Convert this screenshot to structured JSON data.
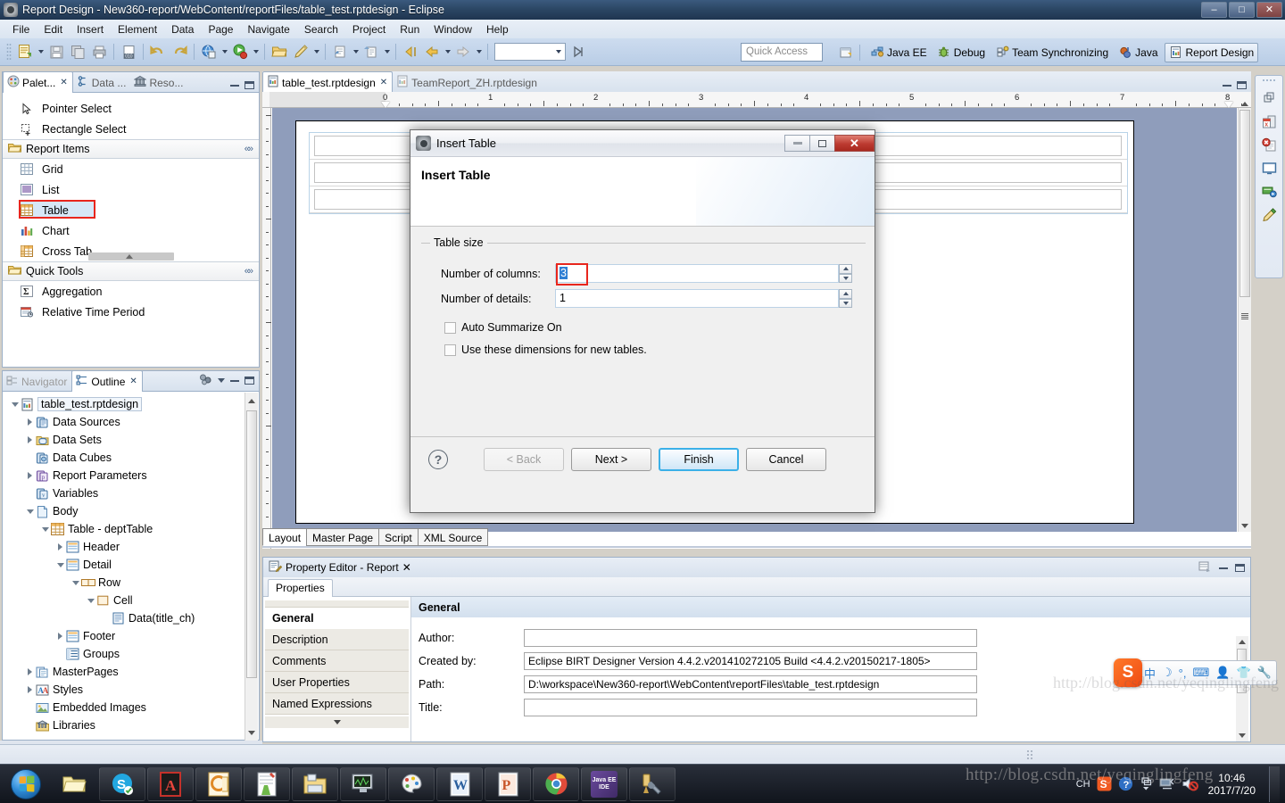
{
  "window": {
    "title": "Report Design - New360-report/WebContent/reportFiles/table_test.rptdesign - Eclipse",
    "minimize": "–",
    "maximize": "□",
    "close": "✕"
  },
  "menu": [
    "File",
    "Edit",
    "Insert",
    "Element",
    "Data",
    "Page",
    "Navigate",
    "Search",
    "Project",
    "Run",
    "Window",
    "Help"
  ],
  "toolbar": {
    "icons": [
      "new-report-icon",
      "save-icon",
      "save-all-icon",
      "print-icon",
      "data-binding-icon",
      "undo-icon",
      "redo-icon",
      "preview-web-icon",
      "run-report-icon",
      "open-folder-icon",
      "edit-pencil-icon",
      "publish-icon",
      "export-icon",
      "previous-page-icon",
      "back-icon",
      "forward-icon"
    ],
    "combo_value": ""
  },
  "quick_access": {
    "placeholder": "Quick Access"
  },
  "perspectives": [
    {
      "label": "Java EE",
      "icon": "java-ee-icon",
      "active": false
    },
    {
      "label": "Debug",
      "icon": "debug-icon",
      "active": false
    },
    {
      "label": "Team Synchronizing",
      "icon": "team-sync-icon",
      "active": false
    },
    {
      "label": "Java",
      "icon": "java-icon",
      "active": false
    },
    {
      "label": "Report Design",
      "icon": "report-design-icon",
      "active": true
    }
  ],
  "palette": {
    "tabs": [
      {
        "label": "Palet...",
        "icon": "palette-icon",
        "active": true,
        "closable": true
      },
      {
        "label": "Data ...",
        "icon": "data-explorer-icon",
        "active": false,
        "closable": false
      },
      {
        "label": "Reso...",
        "icon": "resource-explorer-icon",
        "active": false,
        "closable": false
      }
    ],
    "tools": [
      {
        "label": "Pointer Select",
        "icon": "pointer-select-icon"
      },
      {
        "label": "Rectangle Select",
        "icon": "rectangle-select-icon"
      }
    ],
    "sections": [
      {
        "label": "Report Items",
        "icon": "folder-open-icon",
        "items": [
          {
            "label": "Grid",
            "icon": "grid-icon",
            "selected": false
          },
          {
            "label": "List",
            "icon": "list-icon",
            "selected": false
          },
          {
            "label": "Table",
            "icon": "table-icon",
            "selected": true
          },
          {
            "label": "Chart",
            "icon": "chart-icon",
            "selected": false
          },
          {
            "label": "Cross Tab",
            "icon": "cross-tab-icon",
            "selected": false
          }
        ]
      },
      {
        "label": "Quick Tools",
        "icon": "folder-open-icon",
        "items": [
          {
            "label": "Aggregation",
            "icon": "aggregation-icon",
            "selected": false
          },
          {
            "label": "Relative Time Period",
            "icon": "relative-time-period-icon",
            "selected": false
          }
        ]
      }
    ]
  },
  "outline": {
    "tabs": [
      {
        "label": "Navigator",
        "icon": "navigator-icon",
        "active": false
      },
      {
        "label": "Outline",
        "icon": "outline-icon",
        "active": true,
        "closable": true
      }
    ],
    "tree": [
      {
        "label": "table_test.rptdesign",
        "depth": 0,
        "arrow": "open",
        "icon": "report-file-icon",
        "selected": true
      },
      {
        "label": "Data Sources",
        "depth": 1,
        "arrow": "closed",
        "icon": "data-sources-icon"
      },
      {
        "label": "Data Sets",
        "depth": 1,
        "arrow": "closed",
        "icon": "data-sets-icon"
      },
      {
        "label": "Data Cubes",
        "depth": 1,
        "arrow": "none",
        "icon": "data-cubes-icon"
      },
      {
        "label": "Report Parameters",
        "depth": 1,
        "arrow": "closed",
        "icon": "report-parameters-icon"
      },
      {
        "label": "Variables",
        "depth": 1,
        "arrow": "none",
        "icon": "variables-icon"
      },
      {
        "label": "Body",
        "depth": 1,
        "arrow": "open",
        "icon": "body-icon"
      },
      {
        "label": "Table - deptTable",
        "depth": 2,
        "arrow": "open",
        "icon": "table-icon"
      },
      {
        "label": "Header",
        "depth": 3,
        "arrow": "closed",
        "icon": "band-icon"
      },
      {
        "label": "Detail",
        "depth": 3,
        "arrow": "open",
        "icon": "band-icon"
      },
      {
        "label": "Row",
        "depth": 4,
        "arrow": "open",
        "icon": "row-icon"
      },
      {
        "label": "Cell",
        "depth": 5,
        "arrow": "open",
        "icon": "cell-icon"
      },
      {
        "label": "Data(title_ch)",
        "depth": 6,
        "arrow": "none",
        "icon": "data-item-icon"
      },
      {
        "label": "Footer",
        "depth": 3,
        "arrow": "closed",
        "icon": "band-icon"
      },
      {
        "label": "Groups",
        "depth": 3,
        "arrow": "none",
        "icon": "groups-icon"
      },
      {
        "label": "MasterPages",
        "depth": 1,
        "arrow": "closed",
        "icon": "master-pages-icon"
      },
      {
        "label": "Styles",
        "depth": 1,
        "arrow": "closed",
        "icon": "styles-icon"
      },
      {
        "label": "Embedded Images",
        "depth": 1,
        "arrow": "none",
        "icon": "embedded-images-icon"
      },
      {
        "label": "Libraries",
        "depth": 1,
        "arrow": "none",
        "icon": "libraries-icon"
      }
    ]
  },
  "editor": {
    "tabs": [
      {
        "label": "table_test.rptdesign",
        "icon": "report-file-icon",
        "active": true,
        "closable": true
      },
      {
        "label": "TeamReport_ZH.rptdesign",
        "icon": "report-file-icon",
        "active": false,
        "closable": false
      }
    ],
    "ruler_units": [
      "0",
      "1",
      "2",
      "3",
      "4",
      "5",
      "6",
      "7",
      "8"
    ],
    "layout_tabs": [
      {
        "label": "Layout",
        "mnemonic": "o",
        "active": true
      },
      {
        "label": "Master Page",
        "mnemonic": "M",
        "active": false
      },
      {
        "label": "Script",
        "mnemonic": "S",
        "active": false
      },
      {
        "label": "XML Source",
        "mnemonic": "X",
        "active": false
      }
    ]
  },
  "property_editor": {
    "view_title": "Property Editor - Report",
    "view_icon": "property-editor-icon",
    "tab": "Properties",
    "side_items": [
      {
        "label": "General",
        "active": true
      },
      {
        "label": "Description",
        "active": false
      },
      {
        "label": "Comments",
        "active": false
      },
      {
        "label": "User Properties",
        "active": false
      },
      {
        "label": "Named Expressions",
        "active": false
      }
    ],
    "section_title": "General",
    "fields": [
      {
        "label": "Author:",
        "mnemonic": "u",
        "value": ""
      },
      {
        "label": "Created by:",
        "mnemonic": "C",
        "value": "Eclipse BIRT Designer Version 4.4.2.v201410272105 Build <4.4.2.v20150217-1805>"
      },
      {
        "label": "Path:",
        "mnemonic": "P",
        "value": "D:\\workspace\\New360-report\\WebContent\\reportFiles\\table_test.rptdesign"
      },
      {
        "label": "Title:",
        "mnemonic": "i",
        "value": ""
      }
    ]
  },
  "fast_view": {
    "icons": [
      "restore-icon",
      "excel-report-icon",
      "error-log-icon",
      "console-icon",
      "servers-icon",
      "outline-pencil-icon"
    ]
  },
  "dialog": {
    "window_title": "Insert Table",
    "heading": "Insert Table",
    "group_label": "Table size",
    "fields": [
      {
        "label": "Number of columns:",
        "value": "3",
        "focused": true
      },
      {
        "label": "Number of details:",
        "value": "1",
        "focused": false
      }
    ],
    "checkboxes": [
      {
        "label": "Auto Summarize On",
        "checked": false
      },
      {
        "label": "Use these dimensions for new tables.",
        "checked": false
      }
    ],
    "help_icon": "help-question-icon",
    "buttons": [
      {
        "label": "< Back",
        "state": "disabled"
      },
      {
        "label": "Next >",
        "state": "normal"
      },
      {
        "label": "Finish",
        "state": "default"
      },
      {
        "label": "Cancel",
        "state": "normal"
      }
    ],
    "titlebar_buttons": {
      "minimize": "minimize-icon",
      "maximize": "maximize-icon",
      "close": "✕"
    }
  },
  "ime": {
    "logo": "S",
    "items": [
      "中",
      "☽",
      "°,",
      "⌨",
      "👤",
      "👕",
      "🔧"
    ]
  },
  "taskbar": {
    "start": "windows-start-orb",
    "apps": [
      {
        "name": "explorer-icon",
        "label": ""
      },
      {
        "name": "skype-icon",
        "label": "S"
      },
      {
        "name": "adobe-reader-icon",
        "label": "A"
      },
      {
        "name": "outlook-icon",
        "label": "O"
      },
      {
        "name": "notepad-icon",
        "label": ""
      },
      {
        "name": "file-manager-icon",
        "label": ""
      },
      {
        "name": "monitor-tool-icon",
        "label": ""
      },
      {
        "name": "paint-icon",
        "label": ""
      },
      {
        "name": "word-icon",
        "label": "W"
      },
      {
        "name": "powerpoint-icon",
        "label": "P"
      },
      {
        "name": "chrome-icon",
        "label": ""
      },
      {
        "name": "java-ee-ide-icon",
        "label": "Java EE IDE"
      },
      {
        "name": "tools-icon",
        "label": ""
      }
    ],
    "tray": [
      "CH",
      "sogou-icon",
      "help-icon",
      "network-icon",
      "volume-icon"
    ],
    "clock_time": "10:46",
    "clock_date": "2017/7/20"
  },
  "watermark": {
    "text": "http://blog.csdn.net/yeqinglingfeng"
  },
  "colors": {
    "accent_red": "#e8261d",
    "title_blue": "#2c4765",
    "toolbar_blue": "#b9cde6",
    "canvas_blue": "#8f9dbb",
    "default_button_blue": "#3bb0e8"
  }
}
